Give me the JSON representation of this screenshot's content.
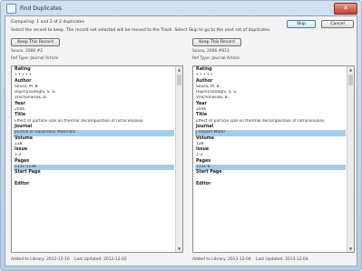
{
  "window": {
    "title": "Find Duplicates",
    "close_glyph": "✕"
  },
  "header": {
    "comparing": "Comparing: 1 and 2 of 2 duplicates",
    "instructions": "Select the record to keep. The record not selected will be moved to the Trash. Select Skip to go to the next set of duplicates.",
    "skip_label": "Skip",
    "cancel_label": "Cancel"
  },
  "left": {
    "keep_label": "Keep This Record",
    "ref_line": "Sousa, 2006 #2",
    "ref_type": "Ref Type: Journal Article",
    "fields": [
      {
        "label": "Rating",
        "lines": [
          "• • • • •"
        ],
        "hl": false
      },
      {
        "label": "Author",
        "lines": [
          "Sousa, M. B.",
          "Hajimirsadeghi, S. S.",
          "Vlachonasiak, B."
        ],
        "hl": false
      },
      {
        "label": "Year",
        "lines": [
          "2006"
        ],
        "hl": false
      },
      {
        "label": "Title",
        "lines": [
          "Effect of particle size on thermal decomposition of nitrocellulose"
        ],
        "hl": false
      },
      {
        "label": "Journal",
        "lines": [
          "Journal of Hazardous Materials"
        ],
        "hl": true
      },
      {
        "label": "Volume",
        "lines": [
          "138"
        ],
        "hl": false
      },
      {
        "label": "Issue",
        "lines": [
          "1-3"
        ],
        "hl": false
      },
      {
        "label": "Pages",
        "lines": [
          "1131-1138"
        ],
        "hl": true
      },
      {
        "label": "Start Page",
        "lines": [
          ""
        ],
        "hl": false
      },
      {
        "label": "Editor",
        "lines": [],
        "hl": false
      }
    ],
    "footer": {
      "added": "Added to Library: 2012-12-10",
      "updated": "Last Updated: 2012-12-02"
    }
  },
  "right": {
    "keep_label": "Keep This Record",
    "ref_line": "Sousa, 2006 #813",
    "ref_type": "Ref Type: Journal Article",
    "fields": [
      {
        "label": "Rating",
        "lines": [
          "• • • • •"
        ],
        "hl": false
      },
      {
        "label": "Author",
        "lines": [
          "Sousa, M. B.",
          "Hajimirsadeghi, S. S.",
          "Vlachonasiak, B."
        ],
        "hl": false
      },
      {
        "label": "Year",
        "lines": [
          "2006"
        ],
        "hl": false
      },
      {
        "label": "Title",
        "lines": [
          "Effect of particle size on thermal decomposition of nitrocellulose"
        ],
        "hl": false
      },
      {
        "label": "Journal",
        "lines": [
          "J Hazard Mater"
        ],
        "hl": true
      },
      {
        "label": "Volume",
        "lines": [
          "138"
        ],
        "hl": false
      },
      {
        "label": "Issue",
        "lines": [
          "1-3"
        ],
        "hl": false
      },
      {
        "label": "Pages",
        "lines": [
          "1131-8"
        ],
        "hl": true
      },
      {
        "label": "Start Page",
        "lines": [
          ""
        ],
        "hl": false
      },
      {
        "label": "Editor",
        "lines": [],
        "hl": false
      }
    ],
    "footer": {
      "added": "Added to Library: 2013-12-04",
      "updated": "Last Updated: 2013-12-04"
    }
  },
  "scroll": {
    "up": "▲",
    "down": "▼"
  }
}
